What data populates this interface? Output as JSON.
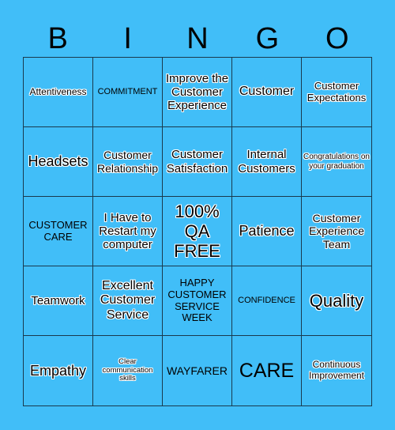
{
  "header": {
    "letters": [
      "B",
      "I",
      "N",
      "G",
      "O"
    ]
  },
  "colors": {
    "background": "#41bef8",
    "grid_line": "#1a3a4e",
    "text": "#000000",
    "text_outline": "#ffffff"
  },
  "board": {
    "rows": [
      [
        "Attentiveness",
        "COMMITMENT",
        "Improve the Customer Experience",
        "Customer",
        "Customer Expectations"
      ],
      [
        "Headsets",
        "Customer Relationship",
        "Customer Satisfaction",
        "Internal Customers",
        "Congratulations on your graduation"
      ],
      [
        "CUSTOMER CARE",
        "I Have to Restart my computer",
        "100% QA FREE",
        "Patience",
        "Customer Experience Team"
      ],
      [
        "Teamwork",
        "Excellent Customer Service",
        "HAPPY CUSTOMER SERVICE WEEK",
        "CONFIDENCE",
        "Quality"
      ],
      [
        "Empathy",
        "Clear communication skills",
        "WAYFARER",
        "CARE",
        "Continuous Improvement"
      ]
    ]
  }
}
